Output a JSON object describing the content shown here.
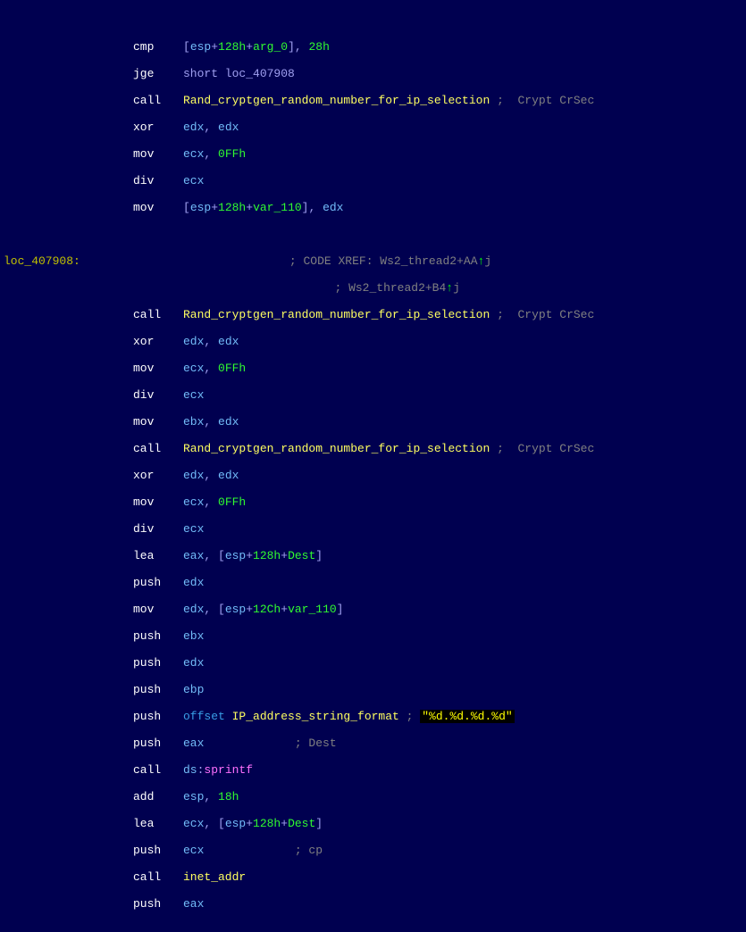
{
  "lines": {
    "l0": {
      "mne": "cmp",
      "a": "[",
      "b": "esp",
      "c": "+",
      "d": "128h",
      "e": "+",
      "f": "arg_0",
      "g": "], ",
      "h": "28h"
    },
    "l1": {
      "mne": "jge",
      "op": "short loc_407908"
    },
    "l2": {
      "mne": "call",
      "fn": "Rand_cryptgen_random_number_for_ip_selection",
      "cm": " ;  Crypt CrSec"
    },
    "l3": {
      "mne": "xor",
      "a": "edx",
      "b": ", ",
      "c": "edx"
    },
    "l4": {
      "mne": "mov",
      "a": "ecx",
      "b": ", ",
      "c": "0FFh"
    },
    "l5": {
      "mne": "div",
      "a": "ecx"
    },
    "l6": {
      "mne": "mov",
      "a": "[",
      "b": "esp",
      "c": "+",
      "d": "128h",
      "e": "+",
      "f": "var_110",
      "g": "], ",
      "h": "edx"
    },
    "l7": {
      "label": "loc_407908:",
      "xref1": "; CODE XREF: Ws2_thread2+AA",
      "arrow1": "↑",
      "j1": "j"
    },
    "l8": {
      "xref2": "; Ws2_thread2+B4",
      "arrow2": "↑",
      "j2": "j"
    },
    "l9": {
      "mne": "call",
      "fn": "Rand_cryptgen_random_number_for_ip_selection",
      "cm": " ;  Crypt CrSec"
    },
    "l10": {
      "mne": "xor",
      "a": "edx",
      "b": ", ",
      "c": "edx"
    },
    "l11": {
      "mne": "mov",
      "a": "ecx",
      "b": ", ",
      "c": "0FFh"
    },
    "l12": {
      "mne": "div",
      "a": "ecx"
    },
    "l13": {
      "mne": "mov",
      "a": "ebx",
      "b": ", ",
      "c": "edx"
    },
    "l14": {
      "mne": "call",
      "fn": "Rand_cryptgen_random_number_for_ip_selection",
      "cm": " ;  Crypt CrSec"
    },
    "l15": {
      "mne": "xor",
      "a": "edx",
      "b": ", ",
      "c": "edx"
    },
    "l16": {
      "mne": "mov",
      "a": "ecx",
      "b": ", ",
      "c": "0FFh"
    },
    "l17": {
      "mne": "div",
      "a": "ecx"
    },
    "l18": {
      "mne": "lea",
      "a": "eax",
      "b": ", [",
      "c": "esp",
      "d": "+",
      "e": "128h",
      "f": "+",
      "g": "Dest",
      "h": "]"
    },
    "l19": {
      "mne": "push",
      "a": "edx"
    },
    "l20": {
      "mne": "mov",
      "a": "edx",
      "b": ", [",
      "c": "esp",
      "d": "+",
      "e": "12Ch",
      "f": "+",
      "g": "var_110",
      "h": "]"
    },
    "l21": {
      "mne": "push",
      "a": "ebx"
    },
    "l22": {
      "mne": "push",
      "a": "edx"
    },
    "l23": {
      "mne": "push",
      "a": "ebp"
    },
    "l24": {
      "mne": "push",
      "a": "offset ",
      "b": "IP_address_string_format",
      "cm": " ; ",
      "str": "\"%d.%d.%d.%d\""
    },
    "l25": {
      "mne": "push",
      "a": "eax",
      "cm": "             ; Dest"
    },
    "l26": {
      "mne": "call",
      "a": "ds",
      ":": "",
      ";": "",
      "fn": "sprintf"
    },
    "l27": {
      "mne": "add",
      "a": "esp",
      "b": ", ",
      "c": "18h"
    },
    "l28": {
      "mne": "lea",
      "a": "ecx",
      "b": ", [",
      "c": "esp",
      "d": "+",
      "e": "128h",
      "f": "+",
      "g": "Dest",
      "h": "]"
    },
    "l29": {
      "mne": "push",
      "a": "ecx",
      "cm": "             ; cp"
    },
    "l30": {
      "mne": "call",
      "fn": "inet_addr"
    },
    "l31": {
      "mne": "push",
      "a": "eax"
    }
  }
}
